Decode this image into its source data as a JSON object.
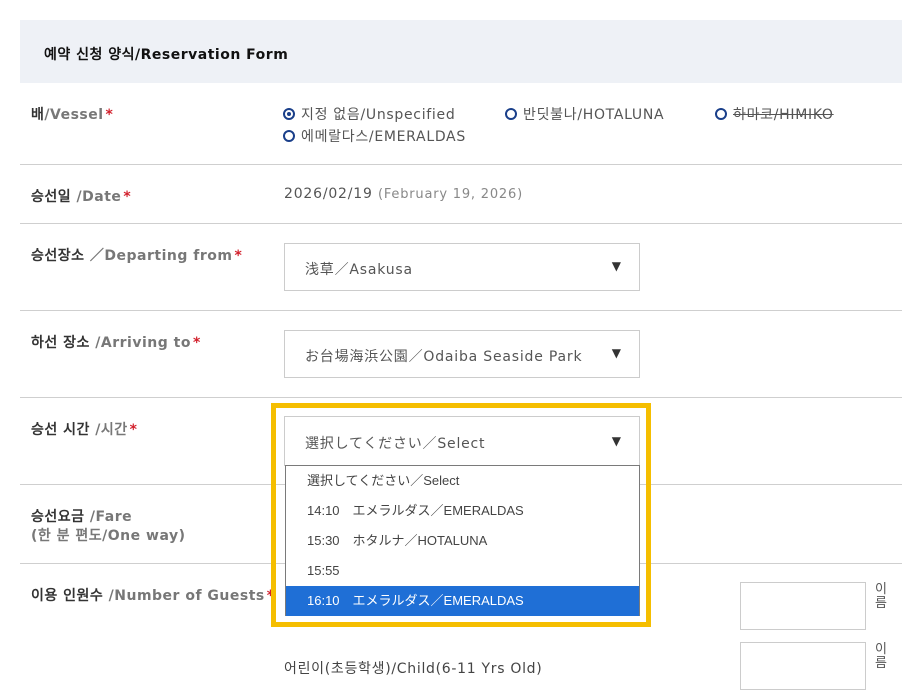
{
  "form": {
    "title": "예약 신청 양식/Reservation Form"
  },
  "vessel": {
    "label_ko": "배",
    "label_en": "/Vessel",
    "required": "*",
    "options": [
      {
        "label": "지정 없음/Unspecified",
        "checked": true
      },
      {
        "label": "반딧불나/HOTALUNA",
        "checked": false
      },
      {
        "label": "하마코/HIMIKO",
        "checked": false,
        "disabled": true
      },
      {
        "label": "에메랄다스/EMERALDAS",
        "checked": false
      }
    ]
  },
  "date": {
    "label_ko": "승선일",
    "label_en": " /Date",
    "required": "*",
    "value": "2026/02/19",
    "value_long": "(February 19, 2026)"
  },
  "departing": {
    "label_ko": "승선장소",
    "label_en": " ／Departing from",
    "required": "*",
    "value": "浅草／Asakusa"
  },
  "arriving": {
    "label_ko": "하선 장소",
    "label_en": " /Arriving to",
    "required": "*",
    "value": "お台場海浜公園／Odaiba Seaside Park"
  },
  "time": {
    "label_ko": "승선 시간",
    "label_en": " /시간",
    "required": "*",
    "value": "選択してください／Select",
    "options": [
      "選択してください／Select",
      "14:10　エメラルダス／EMERALDAS",
      "15:30　ホタルナ／HOTALUNA",
      "15:55",
      "16:10　エメラルダス／EMERALDAS"
    ],
    "highlighted_index": 4
  },
  "fare": {
    "label_ko": "승선요금",
    "label_en": " /Fare",
    "label_sub": "(한 분 편도/One way)"
  },
  "guests": {
    "label_ko": "이용 인원수",
    "label_en": " /Number of Guests",
    "required": "*",
    "unit": "이름",
    "child_label": "어린이(초등학생)/Child(6-11 Yrs Old)"
  },
  "icons": {
    "dropdown_arrow": "▼"
  }
}
